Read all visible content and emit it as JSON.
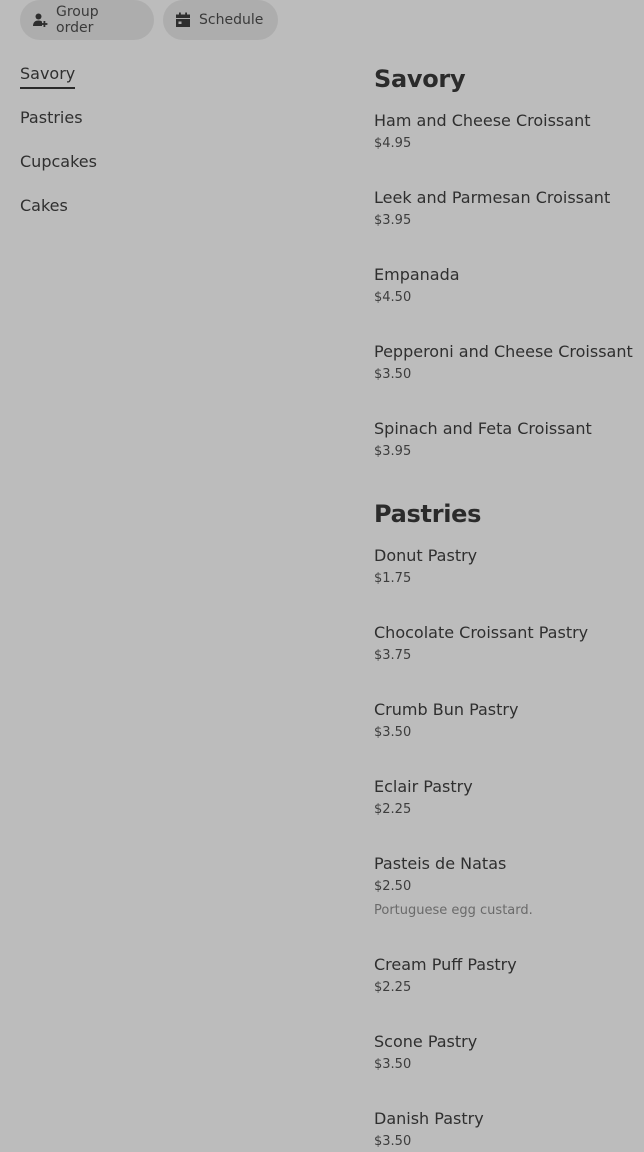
{
  "toolbar": {
    "group_order_label": "Group order",
    "group_order_icon": "user-plus-icon",
    "schedule_label": "Schedule",
    "schedule_icon": "calendar-icon"
  },
  "categories": [
    {
      "label": "Savory",
      "active": true
    },
    {
      "label": "Pastries",
      "active": false
    },
    {
      "label": "Cupcakes",
      "active": false
    },
    {
      "label": "Cakes",
      "active": false
    }
  ],
  "sections": [
    {
      "title": "Savory",
      "items": [
        {
          "name": "Ham and Cheese Croissant",
          "price": "$4.95"
        },
        {
          "name": "Leek and Parmesan Croissant",
          "price": "$3.95"
        },
        {
          "name": "Empanada",
          "price": "$4.50"
        },
        {
          "name": "Pepperoni and Cheese Croissant",
          "price": "$3.50"
        },
        {
          "name": "Spinach and Feta Croissant",
          "price": "$3.95"
        }
      ]
    },
    {
      "title": "Pastries",
      "items": [
        {
          "name": "Donut Pastry",
          "price": "$1.75"
        },
        {
          "name": "Chocolate Croissant Pastry",
          "price": "$3.75"
        },
        {
          "name": "Crumb Bun Pastry",
          "price": "$3.50"
        },
        {
          "name": "Eclair Pastry",
          "price": "$2.25"
        },
        {
          "name": "Pasteis de Natas",
          "price": "$2.50",
          "description": "Portuguese egg custard."
        },
        {
          "name": "Cream Puff Pastry",
          "price": "$2.25"
        },
        {
          "name": "Scone Pastry",
          "price": "$3.50"
        },
        {
          "name": "Danish Pastry",
          "price": "$3.50"
        }
      ]
    }
  ]
}
